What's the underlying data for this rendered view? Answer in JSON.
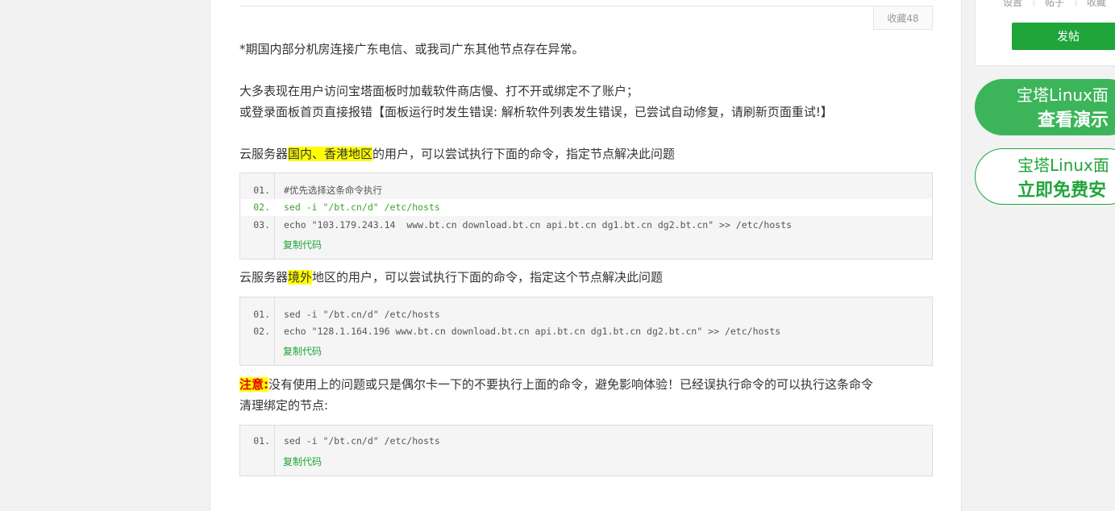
{
  "favorite_label": "收藏48",
  "sidebar": {
    "tabs": [
      "设置",
      "帖子",
      "收藏"
    ],
    "post_button": "发帖",
    "banner_demo": {
      "line1": "宝塔Linux面",
      "line2": "查看演示"
    },
    "banner_install": {
      "line1": "宝塔Linux面",
      "line2": "立即免费安"
    }
  },
  "article": {
    "notice": "*期国内部分机房连接广东电信、或我司广东其他节点存在异常。",
    "symptom1": "大多表现在用户访问宝塔面板时加载软件商店慢、打不开或绑定不了账户；",
    "symptom2": "或登录面板首页直接报错【面板运行时发生错误: 解析软件列表发生错误，已尝试自动修复，请刷新页面重试!】",
    "domestic_pre": "云服务器",
    "domestic_hl": "国内、香港地区",
    "domestic_post": "的用户，可以尝试执行下面的命令，指定节点解决此问题",
    "overseas_pre": "云服务器",
    "overseas_hl": "境外",
    "overseas_post": "地区的用户，可以尝试执行下面的命令，指定这个节点解决此问题",
    "warn_label": "注意:",
    "warn_text1": "没有使用上的问题或只是偶尔卡一下的不要执行上面的命令，避免影响体验！已经误执行命令的可以执行这条命令",
    "warn_text2": "清理绑定的节点:"
  },
  "code_blocks": [
    {
      "lines": [
        {
          "num": "01.",
          "text": "#优先选择这条命令执行"
        },
        {
          "num": "02.",
          "text": "sed -i \"/bt.cn/d\" /etc/hosts"
        },
        {
          "num": "03.",
          "text": "echo \"103.179.243.14  www.bt.cn download.bt.cn api.bt.cn dg1.bt.cn dg2.bt.cn\" >> /etc/hosts"
        }
      ],
      "copy_label": "复制代码"
    },
    {
      "lines": [
        {
          "num": "01.",
          "text": "sed -i \"/bt.cn/d\" /etc/hosts"
        },
        {
          "num": "02.",
          "text": "echo \"128.1.164.196 www.bt.cn download.bt.cn api.bt.cn dg1.bt.cn dg2.bt.cn\" >> /etc/hosts"
        }
      ],
      "copy_label": "复制代码"
    },
    {
      "lines": [
        {
          "num": "01.",
          "text": "sed -i \"/bt.cn/d\" /etc/hosts"
        }
      ],
      "copy_label": "复制代码"
    }
  ]
}
